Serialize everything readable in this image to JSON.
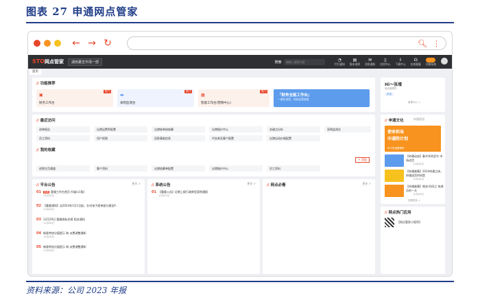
{
  "figure": {
    "title": "图表 27  申通网点管家",
    "source": "资料来源：公司 2023 年报"
  },
  "app": {
    "logo_main": "STO",
    "logo_sub": "网点管家",
    "network_select": "湖南董吉市场一部",
    "search_label": "搜索",
    "search_placeholder": "请输入搜索内容",
    "tools": [
      {
        "icon": "bell",
        "label": "钉钉通知"
      },
      {
        "icon": "doc",
        "label": "版本说明"
      },
      {
        "icon": "mail",
        "label": "消息通知"
      },
      {
        "icon": "phone",
        "label": "应用中心"
      },
      {
        "icon": "download",
        "label": "下载中心"
      },
      {
        "icon": "headset",
        "label": "在线客服"
      },
      {
        "icon": "toggle",
        "label": "切换系统"
      }
    ],
    "tab": "首页"
  },
  "functions": {
    "title": "功能推荐",
    "items": [
      {
        "label": "财务工作台",
        "badge": "热门"
      },
      {
        "label": "采购监测台",
        "badge": "热门"
      },
      {
        "label": "智能工作台(营销中心)",
        "badge": "热门"
      }
    ],
    "banner_title": "「财务全能工作台」",
    "banner_sub": "一键化流程，加快运营速度"
  },
  "recent": {
    "title": "最近访问",
    "items": [
      "进单报告",
      "出港运费率配置",
      "出港账单核结算",
      "出港报价中心",
      "关键点分析",
      "采购监测台",
      "员工资料",
      "用户权限",
      "回款基础信息",
      "代金券及客户配置",
      "出港自动价格配置"
    ]
  },
  "favorites": {
    "title": "我的收藏",
    "edit": "+ 添加",
    "items": [
      "进港主页通道",
      "客户资料",
      "出港结算单配置",
      "出港报价中心",
      "员工资料"
    ]
  },
  "platform": {
    "title": "平台公告",
    "more": "更多 >",
    "items": [
      {
        "num": "01",
        "tag": "系统",
        "text": "客服工作台首页 升级(v1版)",
        "date": "12月29日"
      },
      {
        "num": "02",
        "tag": "",
        "text": "【重要通知】自2024年1月1日起，针对电子面单部分报告P...",
        "date": "12月26日"
      },
      {
        "num": "03",
        "tag": "",
        "text": "12月29日 客服隐私合规 相关通知",
        "date": "12月26日"
      },
      {
        "num": "04",
        "tag": "",
        "text": "新版考核分值提示 和 派费调整通知",
        "date": "12月26日"
      },
      {
        "num": "05",
        "tag": "",
        "text": "新版考核分值提示 和 派费调整通知",
        "date": "12月26日"
      }
    ]
  },
  "system": {
    "title": "系统公告",
    "more": "更多 >",
    "items": [
      {
        "num": "01",
        "text": "【重要公告】近期上报行政典型案例通报",
        "date": "12月22日"
      }
    ]
  },
  "network": {
    "title": "网点必看",
    "more": "更多 >"
  },
  "user": {
    "greeting": "Hi～张增",
    "role": "网点管理员",
    "btn": "新增",
    "link": "管理中心 >"
  },
  "culture": {
    "title": "申通文化",
    "tab": "申通家园",
    "hero_line1": "使命担当",
    "hero_line2": "中通院计划",
    "hero_caption": "学习先进看榜样",
    "news": [
      {
        "text": "【申通动态】春节共同坚守 市场进货",
        "sub": "12月28日"
      },
      {
        "text": "【申通故事】2024申通之体，申通送货时间是",
        "sub": "12月28日"
      },
      {
        "text": "【申通故事】物流 时间之 快递员的一天",
        "sub": "12月26日"
      }
    ],
    "more": "查看更多 >"
  },
  "apps": {
    "title": "网点热门应用",
    "item": "【网点管家小程序】"
  },
  "colors": {
    "accent": "#e8462a",
    "header": "#2e2f33",
    "banner": "#5d9cec",
    "rule": "#1f3c88"
  }
}
